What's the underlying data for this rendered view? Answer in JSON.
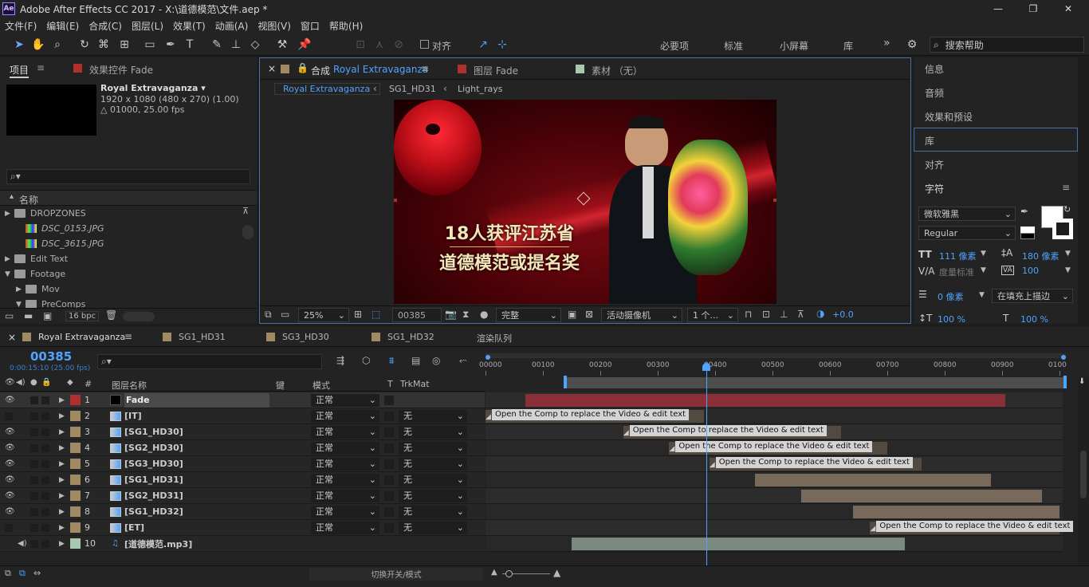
{
  "app": {
    "title": "Adobe After Effects CC 2017 - X:\\道德模范\\文件.aep *",
    "logo": "Ae",
    "window_controls": {
      "minimize": "—",
      "maximize": "❐",
      "close": "✕"
    }
  },
  "menu": [
    "文件(F)",
    "编辑(E)",
    "合成(C)",
    "图层(L)",
    "效果(T)",
    "动画(A)",
    "视图(V)",
    "窗口",
    "帮助(H)"
  ],
  "toolbar": {
    "align_label": "对齐",
    "workspaces": [
      "必要项",
      "标准",
      "小屏幕",
      "库"
    ],
    "more": "»",
    "search_placeholder": "搜索帮助"
  },
  "project_panel": {
    "tab_project": "项目",
    "tab_effects": "效果控件 Fade",
    "comp_name": "Royal Extravaganza ▾",
    "comp_res": "1920 x 1080  (480 x 270) (1.00)",
    "comp_dur": "△ 01000, 25.00 fps",
    "column_name": "名称",
    "bpc": "16 bpc",
    "items": [
      {
        "name": "DROPZONES",
        "kind": "folder",
        "depth": 0,
        "open": false
      },
      {
        "name": "DSC_0153.JPG",
        "kind": "image",
        "depth": 1,
        "open": false
      },
      {
        "name": "DSC_3615.JPG",
        "kind": "image",
        "depth": 1,
        "open": false
      },
      {
        "name": "Edit Text",
        "kind": "folder",
        "depth": 0,
        "open": false
      },
      {
        "name": "Footage",
        "kind": "folder",
        "depth": 0,
        "open": true
      },
      {
        "name": "Mov",
        "kind": "folder",
        "depth": 1,
        "open": false
      },
      {
        "name": "PreComps",
        "kind": "folder",
        "depth": 1,
        "open": true
      }
    ]
  },
  "comp_panel": {
    "tab_comp_prefix": "合成",
    "tab_comp_name": "Royal Extravaganza",
    "tab_layer": "图层 Fade",
    "tab_footage": "素材 （无）",
    "breadcrumb": [
      "Royal Extravaganza",
      "SG1_HD31",
      "Light_rays"
    ],
    "caption_line1": "18人获评江苏省",
    "caption_line2": "道德模范或提名奖",
    "zoom": "25%",
    "timecode": "00385",
    "resolution": "完整",
    "camera": "活动摄像机",
    "views": "1 个...",
    "exposure": "+0.0"
  },
  "right_panel": {
    "items": [
      "信息",
      "音频",
      "效果和预设",
      "库",
      "对齐",
      "字符"
    ],
    "font": "微软雅黑",
    "style": "Regular",
    "size": "111 像素",
    "leading": "180 像素",
    "kerning": "度量标准",
    "tracking": "100",
    "stroke": "0 像素",
    "stroke_mode": "在填充上描边",
    "vscale": "100 %",
    "hscale": "100 %"
  },
  "timeline": {
    "tabs": [
      "Royal Extravaganza",
      "SG1_HD31",
      "SG3_HD30",
      "SG1_HD32",
      "渲染队列"
    ],
    "timecode": "00385",
    "timecode_sub": "0:00:15:10 (25.00 fps)",
    "col_num": "#",
    "col_name": "图层名称",
    "col_key": "键",
    "col_mode": "模式",
    "col_t": "T",
    "col_trkmat": "TrkMat",
    "ruler": [
      "00000",
      "00100",
      "00200",
      "00300",
      "00400",
      "00500",
      "00600",
      "00700",
      "00800",
      "00900",
      "0100"
    ],
    "playhead_frame": 385,
    "toggle_label": "切换开关/模式",
    "layers": [
      {
        "num": "1",
        "name": "Fade",
        "mode": "正常",
        "trk": "",
        "color": "#b03030",
        "eye": true,
        "selected": true
      },
      {
        "num": "2",
        "name": "[IT]",
        "mode": "正常",
        "trk": "无",
        "color": "#a08a64",
        "eye": false
      },
      {
        "num": "3",
        "name": "[SG1_HD30]",
        "mode": "正常",
        "trk": "无",
        "color": "#a08a64",
        "eye": true
      },
      {
        "num": "4",
        "name": "[SG2_HD30]",
        "mode": "正常",
        "trk": "无",
        "color": "#a08a64",
        "eye": true
      },
      {
        "num": "5",
        "name": "[SG3_HD30]",
        "mode": "正常",
        "trk": "无",
        "color": "#a08a64",
        "eye": true
      },
      {
        "num": "6",
        "name": "[SG1_HD31]",
        "mode": "正常",
        "trk": "无",
        "color": "#a08a64",
        "eye": true
      },
      {
        "num": "7",
        "name": "[SG2_HD31]",
        "mode": "正常",
        "trk": "无",
        "color": "#a08a64",
        "eye": true
      },
      {
        "num": "8",
        "name": "[SG1_HD32]",
        "mode": "正常",
        "trk": "无",
        "color": "#a08a64",
        "eye": true
      },
      {
        "num": "9",
        "name": "[ET]",
        "mode": "正常",
        "trk": "无",
        "color": "#a08a64",
        "eye": false
      },
      {
        "num": "10",
        "name": "[道德模范.mp3]",
        "mode": "",
        "trk": "",
        "color": "#a8c8b0",
        "eye": false
      }
    ],
    "marker_text": "Open the Comp to replace the Video & edit text"
  },
  "colors": {
    "accent": "#4fa3ff",
    "label_red": "#b03030",
    "label_sand": "#a08a64",
    "label_aqua": "#a8c8b0"
  }
}
